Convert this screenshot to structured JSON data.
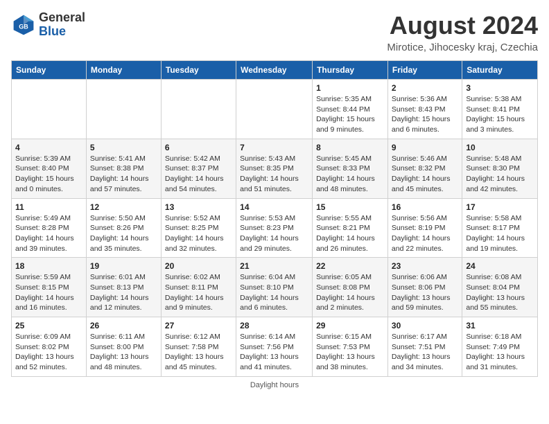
{
  "header": {
    "logo_line1": "General",
    "logo_line2": "Blue",
    "month": "August 2024",
    "location": "Mirotice, Jihocesky kraj, Czechia"
  },
  "days_of_week": [
    "Sunday",
    "Monday",
    "Tuesday",
    "Wednesday",
    "Thursday",
    "Friday",
    "Saturday"
  ],
  "weeks": [
    [
      {
        "day": "",
        "info": ""
      },
      {
        "day": "",
        "info": ""
      },
      {
        "day": "",
        "info": ""
      },
      {
        "day": "",
        "info": ""
      },
      {
        "day": "1",
        "info": "Sunrise: 5:35 AM\nSunset: 8:44 PM\nDaylight: 15 hours and 9 minutes."
      },
      {
        "day": "2",
        "info": "Sunrise: 5:36 AM\nSunset: 8:43 PM\nDaylight: 15 hours and 6 minutes."
      },
      {
        "day": "3",
        "info": "Sunrise: 5:38 AM\nSunset: 8:41 PM\nDaylight: 15 hours and 3 minutes."
      }
    ],
    [
      {
        "day": "4",
        "info": "Sunrise: 5:39 AM\nSunset: 8:40 PM\nDaylight: 15 hours and 0 minutes."
      },
      {
        "day": "5",
        "info": "Sunrise: 5:41 AM\nSunset: 8:38 PM\nDaylight: 14 hours and 57 minutes."
      },
      {
        "day": "6",
        "info": "Sunrise: 5:42 AM\nSunset: 8:37 PM\nDaylight: 14 hours and 54 minutes."
      },
      {
        "day": "7",
        "info": "Sunrise: 5:43 AM\nSunset: 8:35 PM\nDaylight: 14 hours and 51 minutes."
      },
      {
        "day": "8",
        "info": "Sunrise: 5:45 AM\nSunset: 8:33 PM\nDaylight: 14 hours and 48 minutes."
      },
      {
        "day": "9",
        "info": "Sunrise: 5:46 AM\nSunset: 8:32 PM\nDaylight: 14 hours and 45 minutes."
      },
      {
        "day": "10",
        "info": "Sunrise: 5:48 AM\nSunset: 8:30 PM\nDaylight: 14 hours and 42 minutes."
      }
    ],
    [
      {
        "day": "11",
        "info": "Sunrise: 5:49 AM\nSunset: 8:28 PM\nDaylight: 14 hours and 39 minutes."
      },
      {
        "day": "12",
        "info": "Sunrise: 5:50 AM\nSunset: 8:26 PM\nDaylight: 14 hours and 35 minutes."
      },
      {
        "day": "13",
        "info": "Sunrise: 5:52 AM\nSunset: 8:25 PM\nDaylight: 14 hours and 32 minutes."
      },
      {
        "day": "14",
        "info": "Sunrise: 5:53 AM\nSunset: 8:23 PM\nDaylight: 14 hours and 29 minutes."
      },
      {
        "day": "15",
        "info": "Sunrise: 5:55 AM\nSunset: 8:21 PM\nDaylight: 14 hours and 26 minutes."
      },
      {
        "day": "16",
        "info": "Sunrise: 5:56 AM\nSunset: 8:19 PM\nDaylight: 14 hours and 22 minutes."
      },
      {
        "day": "17",
        "info": "Sunrise: 5:58 AM\nSunset: 8:17 PM\nDaylight: 14 hours and 19 minutes."
      }
    ],
    [
      {
        "day": "18",
        "info": "Sunrise: 5:59 AM\nSunset: 8:15 PM\nDaylight: 14 hours and 16 minutes."
      },
      {
        "day": "19",
        "info": "Sunrise: 6:01 AM\nSunset: 8:13 PM\nDaylight: 14 hours and 12 minutes."
      },
      {
        "day": "20",
        "info": "Sunrise: 6:02 AM\nSunset: 8:11 PM\nDaylight: 14 hours and 9 minutes."
      },
      {
        "day": "21",
        "info": "Sunrise: 6:04 AM\nSunset: 8:10 PM\nDaylight: 14 hours and 6 minutes."
      },
      {
        "day": "22",
        "info": "Sunrise: 6:05 AM\nSunset: 8:08 PM\nDaylight: 14 hours and 2 minutes."
      },
      {
        "day": "23",
        "info": "Sunrise: 6:06 AM\nSunset: 8:06 PM\nDaylight: 13 hours and 59 minutes."
      },
      {
        "day": "24",
        "info": "Sunrise: 6:08 AM\nSunset: 8:04 PM\nDaylight: 13 hours and 55 minutes."
      }
    ],
    [
      {
        "day": "25",
        "info": "Sunrise: 6:09 AM\nSunset: 8:02 PM\nDaylight: 13 hours and 52 minutes."
      },
      {
        "day": "26",
        "info": "Sunrise: 6:11 AM\nSunset: 8:00 PM\nDaylight: 13 hours and 48 minutes."
      },
      {
        "day": "27",
        "info": "Sunrise: 6:12 AM\nSunset: 7:58 PM\nDaylight: 13 hours and 45 minutes."
      },
      {
        "day": "28",
        "info": "Sunrise: 6:14 AM\nSunset: 7:56 PM\nDaylight: 13 hours and 41 minutes."
      },
      {
        "day": "29",
        "info": "Sunrise: 6:15 AM\nSunset: 7:53 PM\nDaylight: 13 hours and 38 minutes."
      },
      {
        "day": "30",
        "info": "Sunrise: 6:17 AM\nSunset: 7:51 PM\nDaylight: 13 hours and 34 minutes."
      },
      {
        "day": "31",
        "info": "Sunrise: 6:18 AM\nSunset: 7:49 PM\nDaylight: 13 hours and 31 minutes."
      }
    ]
  ],
  "footer": {
    "note": "Daylight hours"
  }
}
